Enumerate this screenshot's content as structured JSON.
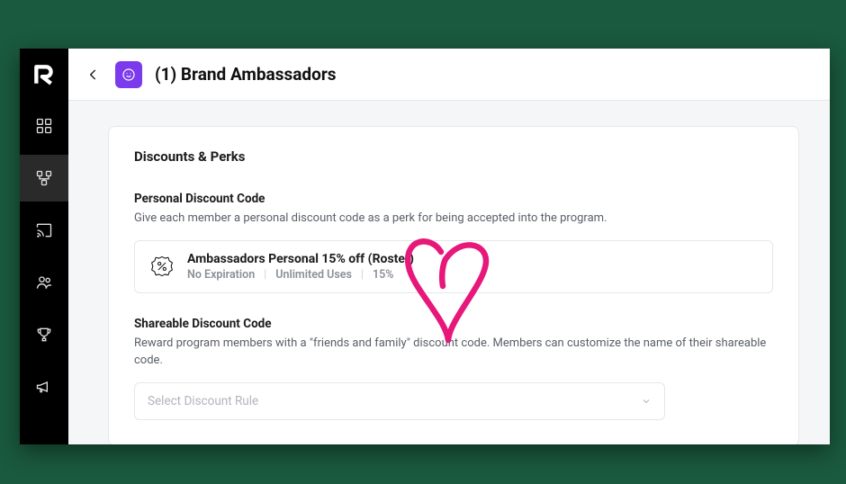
{
  "header": {
    "title": "(1) Brand Ambassadors"
  },
  "card": {
    "title": "Discounts & Perks",
    "personal": {
      "heading": "Personal Discount Code",
      "description": "Give each member a personal discount code as a perk for being accepted into the program.",
      "discount": {
        "name": "Ambassadors Personal 15% off (Roster)",
        "expiration": "No Expiration",
        "uses": "Unlimited Uses",
        "percent": "15%"
      }
    },
    "shareable": {
      "heading": "Shareable Discount Code",
      "description": "Reward program members with a \"friends and family\" discount code. Members can customize the name of their shareable code.",
      "select_placeholder": "Select Discount Rule"
    }
  },
  "sidebar": {
    "items": [
      {
        "key": "dashboard"
      },
      {
        "key": "programs",
        "active": true
      },
      {
        "key": "cast"
      },
      {
        "key": "people"
      },
      {
        "key": "rewards"
      },
      {
        "key": "announce"
      }
    ]
  }
}
